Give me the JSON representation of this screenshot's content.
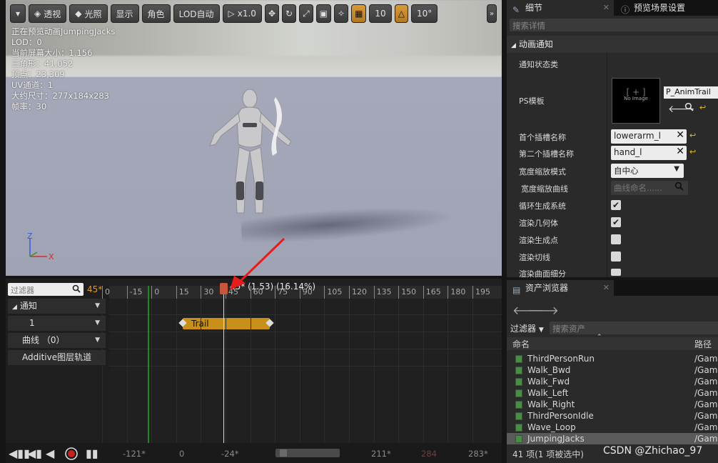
{
  "viewport": {
    "toolbar": {
      "perspective": "透视",
      "lighting": "光照",
      "show": "显示",
      "character": "角色",
      "lod": "LOD自动",
      "speed": "x1.0",
      "grid_value": "10",
      "angle_value": "10°"
    },
    "stats": [
      "正在预览动画JumpingJacks",
      "LOD：0",
      "当前屏幕大小：1.156",
      "三角形：41,052",
      "顶点：23,309",
      "UV通道：1",
      "大约尺寸：277x184x283",
      "帧率：30"
    ],
    "axis": {
      "x": "X",
      "z": "Z"
    }
  },
  "timeline": {
    "filter_placeholder": "过滤器",
    "current_frame": "45*",
    "playhead_label": "45* (1.53) (16.14%)",
    "ticks": [
      "0",
      "-15",
      "0",
      "15",
      "30",
      "45",
      "60",
      "75",
      "90",
      "105",
      "120",
      "135",
      "150",
      "165",
      "180",
      "195"
    ],
    "tracks": {
      "notify": "通知",
      "notify_track": "1",
      "curves": "曲线 （0）",
      "additive": "Additive图层轨道"
    },
    "notify_event": "Trail",
    "bottom_values": {
      "start": "-121*",
      "zero": "0",
      "view_start": "-24*",
      "view_end": "211*",
      "total": "284",
      "end": "283*"
    }
  },
  "details": {
    "tab_details": "细节",
    "tab_preview": "预览场景设置",
    "search_placeholder": "搜索详情",
    "section": "动画通知",
    "labels": {
      "notify_state_class": "通知状态类",
      "ps_template": "PS模板",
      "first_socket": "首个插槽名称",
      "second_socket": "第二个插槽名称",
      "width_mode": "宽度缩放模式",
      "width_curve": "宽度缩放曲线",
      "recycle": "循环生成系统",
      "render_geometry": "渲染几何体",
      "render_spawn_points": "渲染生成点",
      "render_tangents": "渲染切线",
      "render_tess": "渲染曲面细分"
    },
    "ps_template_name": "P_AnimTrail",
    "no_image": "No Image",
    "first_socket_value": "lowerarm_l",
    "second_socket_value": "hand_l",
    "width_mode_value": "自中心",
    "curve_placeholder": "曲线命名......",
    "checks": {
      "recycle": true,
      "render_geometry": true,
      "render_spawn_points": false,
      "render_tangents": false,
      "render_tess": false
    }
  },
  "browser": {
    "title": "资产浏览器",
    "filter_label": "过滤器",
    "search_placeholder": "搜索资产",
    "col_name": "命名",
    "col_path": "路径",
    "assets": [
      {
        "name": "ThirdPersonRun",
        "path": "/Game"
      },
      {
        "name": "Walk_Bwd",
        "path": "/Game"
      },
      {
        "name": "Walk_Fwd",
        "path": "/Game"
      },
      {
        "name": "Walk_Left",
        "path": "/Game"
      },
      {
        "name": "Walk_Right",
        "path": "/Game"
      },
      {
        "name": "ThirdPersonIdle",
        "path": "/Game"
      },
      {
        "name": "Wave_Loop",
        "path": "/Game"
      },
      {
        "name": "JumpingJacks",
        "path": "/Game"
      }
    ],
    "status": "41 项(1 项被选中)",
    "watermark": "CSDN @Zhichao_97"
  }
}
